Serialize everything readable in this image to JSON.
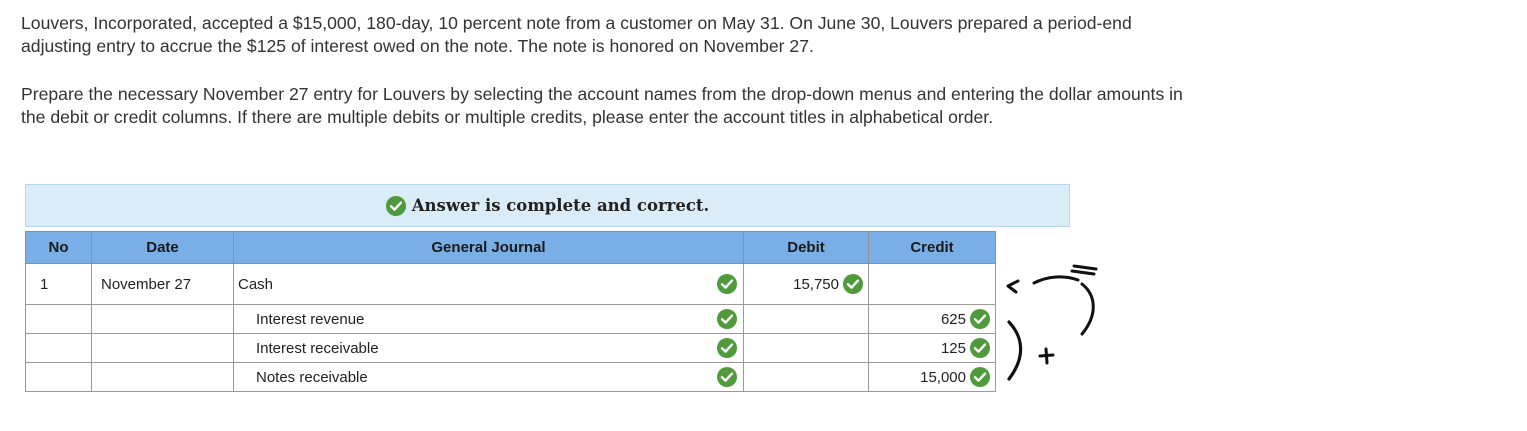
{
  "question": {
    "paragraph1": "Louvers, Incorporated, accepted a $15,000, 180-day, 10 percent note from a customer on May 31. On June 30, Louvers prepared a period-end adjusting entry to accrue the $125 of interest owed on the note. The note is honored on November 27.",
    "paragraph2": "Prepare the necessary November 27 entry for Louvers by selecting the account names from the drop-down menus and entering the dollar amounts in the debit or credit columns. If there are multiple debits or multiple credits, please enter the account titles in alphabetical order."
  },
  "banner": {
    "text": "Answer is complete and correct.",
    "icon": "check-circle-icon"
  },
  "table": {
    "headers": {
      "no": "No",
      "date": "Date",
      "journal": "General Journal",
      "debit": "Debit",
      "credit": "Credit"
    },
    "rows": [
      {
        "no": "1",
        "date": "November 27",
        "account": "Cash",
        "debit": "15,750",
        "credit": ""
      },
      {
        "no": "",
        "date": "",
        "account": "Interest revenue",
        "debit": "",
        "credit": "625"
      },
      {
        "no": "",
        "date": "",
        "account": "Interest receivable",
        "debit": "",
        "credit": "125"
      },
      {
        "no": "",
        "date": "",
        "account": "Notes receivable",
        "debit": "",
        "credit": "15,000"
      }
    ]
  },
  "colors": {
    "check_green": "#4f9a3a",
    "header_blue": "#7aaee6",
    "banner_blue": "#d9ecf8"
  }
}
